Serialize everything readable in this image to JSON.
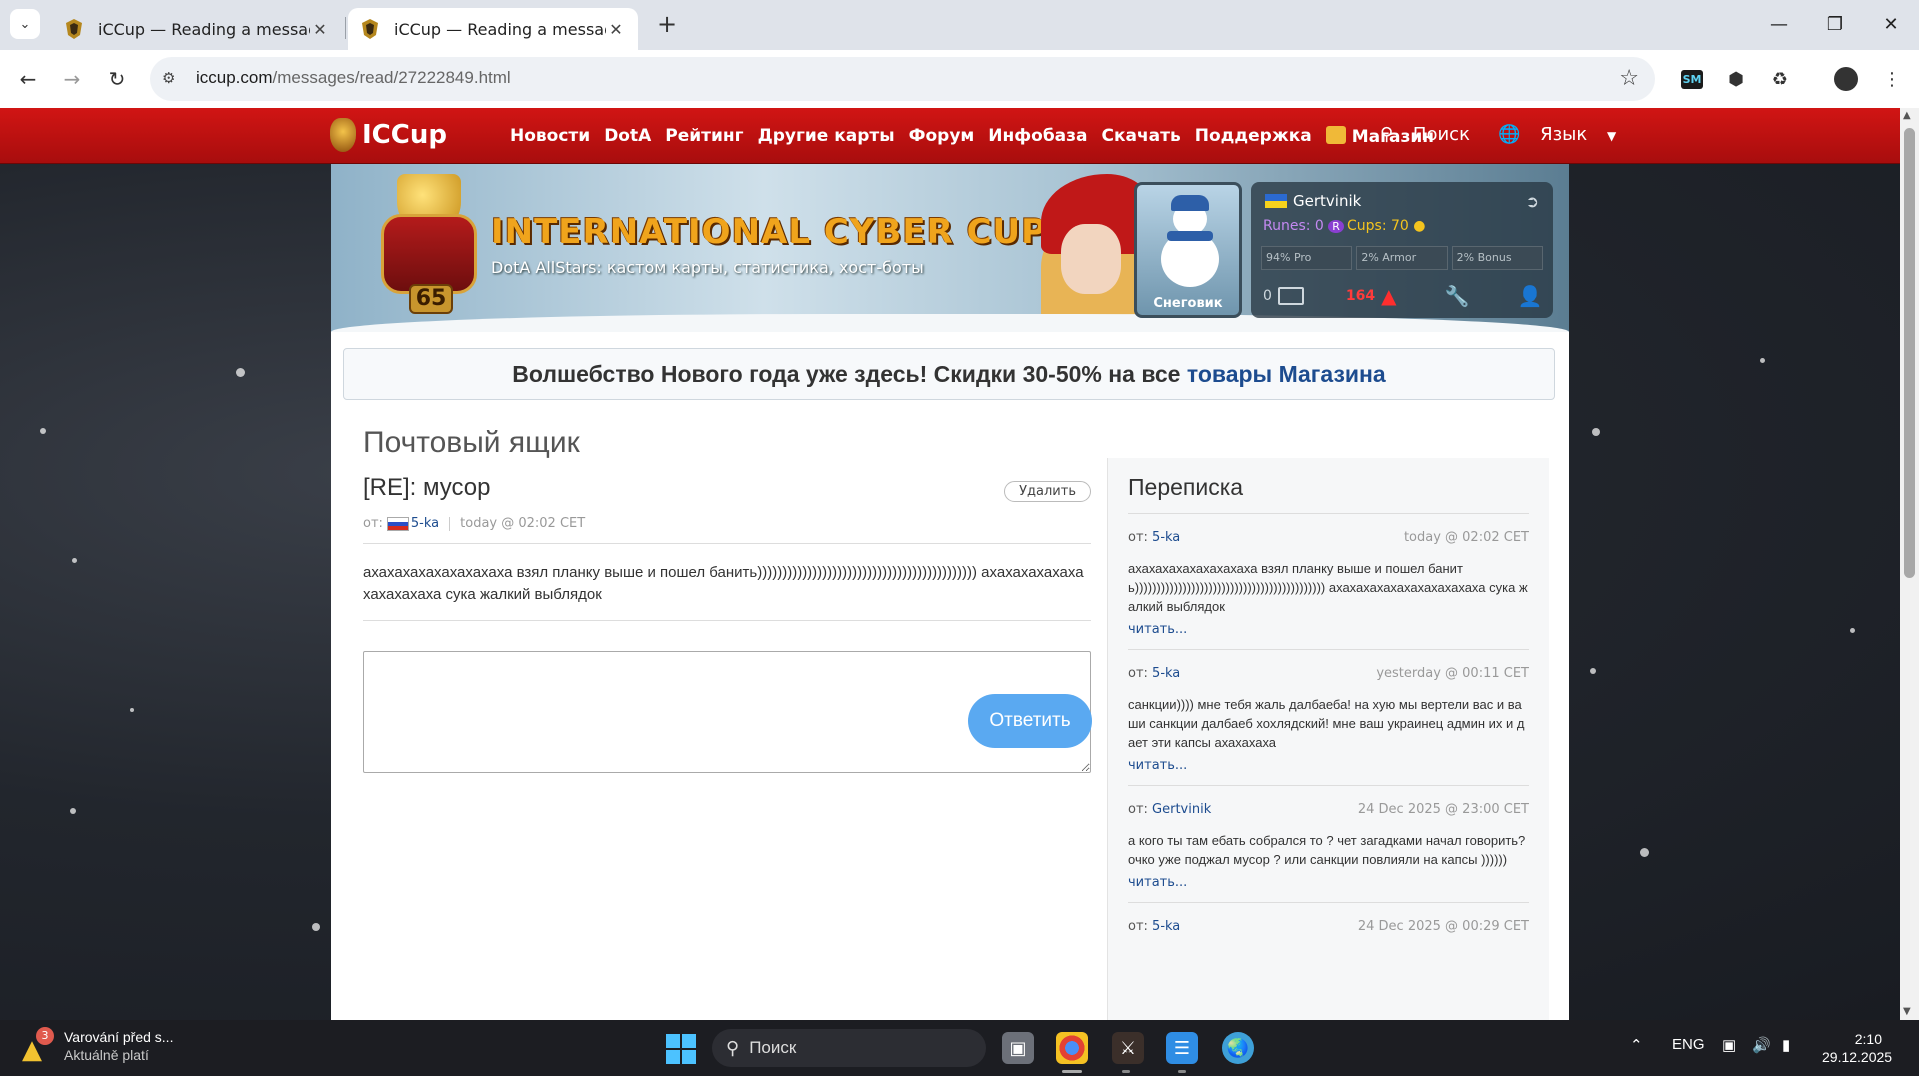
{
  "browser": {
    "tabs": [
      {
        "title": "iCCup — Reading a message fro",
        "active": false
      },
      {
        "title": "iCCup — Reading a message fro",
        "active": true
      }
    ],
    "url_host": "iccup.com",
    "url_path": "/messages/read/27222849.html"
  },
  "site": {
    "logo": "ICCup",
    "menu": [
      "Новости",
      "DotA",
      "Рейтинг",
      "Другие карты",
      "Форум",
      "Инфобаза",
      "Скачать",
      "Поддержка",
      "Магазин"
    ],
    "search": "Поиск",
    "language": "Язык"
  },
  "banner": {
    "level": "65",
    "brand": "INTERNATIONAL CYBER CUP",
    "tagline": "DotA AllStars: кастом карты, статистика, хост-боты"
  },
  "user": {
    "avatar_caption": "Снеговик",
    "username": "Gertvinik",
    "runes": "Runes: 0",
    "cups": "Cups: 70",
    "stats": [
      "94% Pro",
      "2% Armor",
      "2% Bonus"
    ],
    "mail_count": "0",
    "alert_count": "164"
  },
  "promo": {
    "text": "Волшебство Нового года уже здесь! Скидки 30-50% на все ",
    "link": "товары Магазина"
  },
  "mailbox": {
    "title": "Почтовый ящик",
    "message": {
      "subject": "[RE]: мусор",
      "delete_label": "Удалить",
      "from_label": "от:",
      "author": "5-ka",
      "date": "today @ 02:02 CET",
      "body": "ахахахахахахахахаха взял планку выше и пошел банить)))))))))))))))))))))))))))))))))))))))))))) ахахахахахахахахахахаха сука жалкий выблядок"
    },
    "reply_label": "Ответить"
  },
  "conversation": {
    "title": "Переписка",
    "read_more": "читать...",
    "items": [
      {
        "from": "от:",
        "author": "5-ka",
        "date": "today @ 02:02 CET",
        "text": "ахахахахахахахахаха взял планку выше и пошел банить)))))))))))))))))))))))))))))))))))))))))))) ахахахахахахахахахахаха сука жалкий выблядок"
      },
      {
        "from": "от:",
        "author": "5-ka",
        "date": "yesterday @ 00:11 CET",
        "text": "санкции)))) мне тебя жаль далбаеба! на хую мы вертели вас и ваши санкции далбаеб хохлядский! мне ваш украинец админ их и дает эти капсы ахахахаха"
      },
      {
        "from": "от:",
        "author": "Gertvinik",
        "date": "24 Dec 2025 @ 23:00 CET",
        "text": "а кого ты там ебать собрался то ? чет загадками начал говорить? очко уже поджал мусор ? или санкции повлияли на капсы ))))))"
      },
      {
        "from": "от:",
        "author": "5-ka",
        "date": "24 Dec 2025 @ 00:29 CET",
        "text": ""
      }
    ]
  },
  "taskbar": {
    "weather_title": "Varování před s...",
    "weather_sub": "Aktuálně platí",
    "weather_badge": "3",
    "search": "Поиск",
    "lang": "ENG",
    "time": "2:10",
    "date": "29.12.2025"
  }
}
